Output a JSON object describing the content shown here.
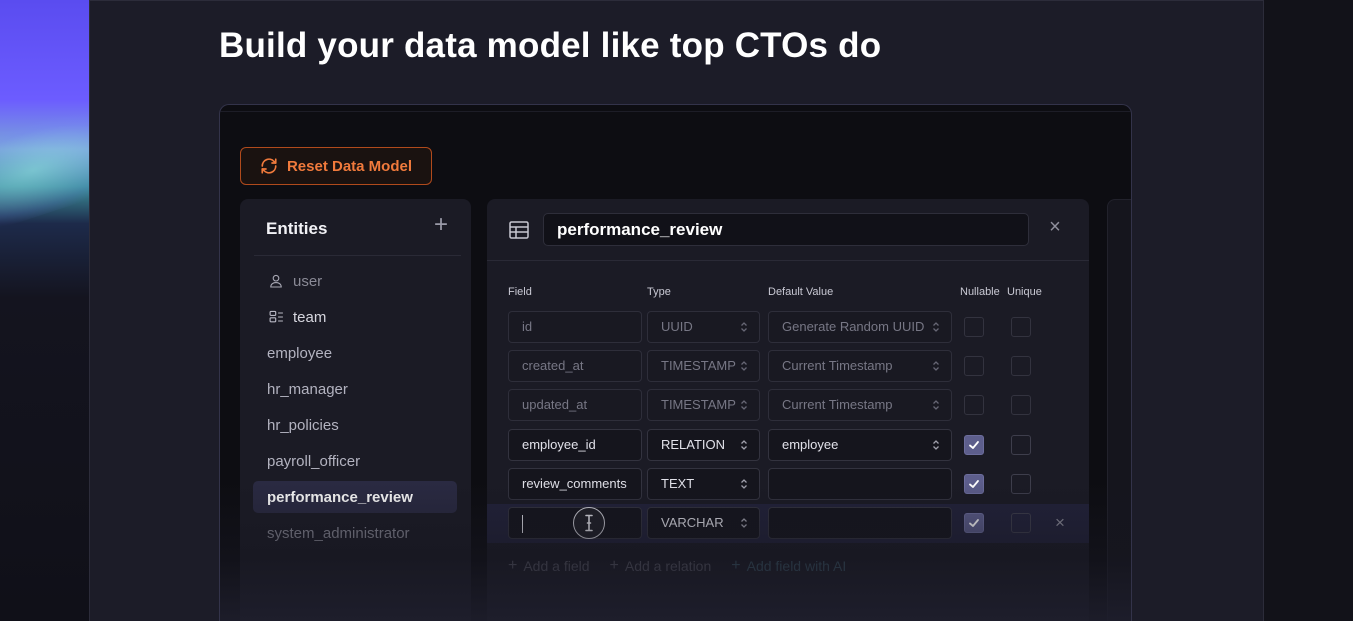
{
  "headline": "Build your data model like top CTOs do",
  "colors": {
    "accent_orange": "#f07a3c",
    "checkbox_fill": "#5d5e8c",
    "active_item": "#2a2a42"
  },
  "reset_button": {
    "label": "Reset Data Model",
    "icon": "refresh-icon"
  },
  "entities": {
    "title": "Entities",
    "add_icon": "plus-icon",
    "items": [
      {
        "label": "user",
        "icon": "user-icon"
      },
      {
        "label": "team",
        "icon": "team-icon"
      },
      {
        "label": "employee"
      },
      {
        "label": "hr_manager"
      },
      {
        "label": "hr_policies"
      },
      {
        "label": "payroll_officer"
      },
      {
        "label": "performance_review",
        "active": true
      },
      {
        "label": "system_administrator"
      }
    ]
  },
  "editor": {
    "entity_name": "performance_review",
    "columns": {
      "field": "Field",
      "type": "Type",
      "default": "Default Value",
      "nullable": "Nullable",
      "unique": "Unique"
    },
    "rows": [
      {
        "field": "id",
        "type": "UUID",
        "default": "Generate Random UUID",
        "nullable": false,
        "unique": false,
        "disabled": true
      },
      {
        "field": "created_at",
        "type": "TIMESTAMP",
        "default": "Current Timestamp",
        "nullable": false,
        "unique": false,
        "disabled": true
      },
      {
        "field": "updated_at",
        "type": "TIMESTAMP",
        "default": "Current Timestamp",
        "nullable": false,
        "unique": false,
        "disabled": true
      },
      {
        "field": "employee_id",
        "type": "RELATION",
        "default": "employee",
        "nullable": true,
        "unique": false
      },
      {
        "field": "review_comments",
        "type": "TEXT",
        "default": "",
        "nullable": true,
        "unique": false
      },
      {
        "field": "",
        "type": "VARCHAR",
        "default": "",
        "nullable": true,
        "unique": false,
        "editing": true
      }
    ],
    "actions": {
      "add_field": "Add a field",
      "add_relation": "Add a relation",
      "add_ai": "Add field with AI"
    }
  }
}
